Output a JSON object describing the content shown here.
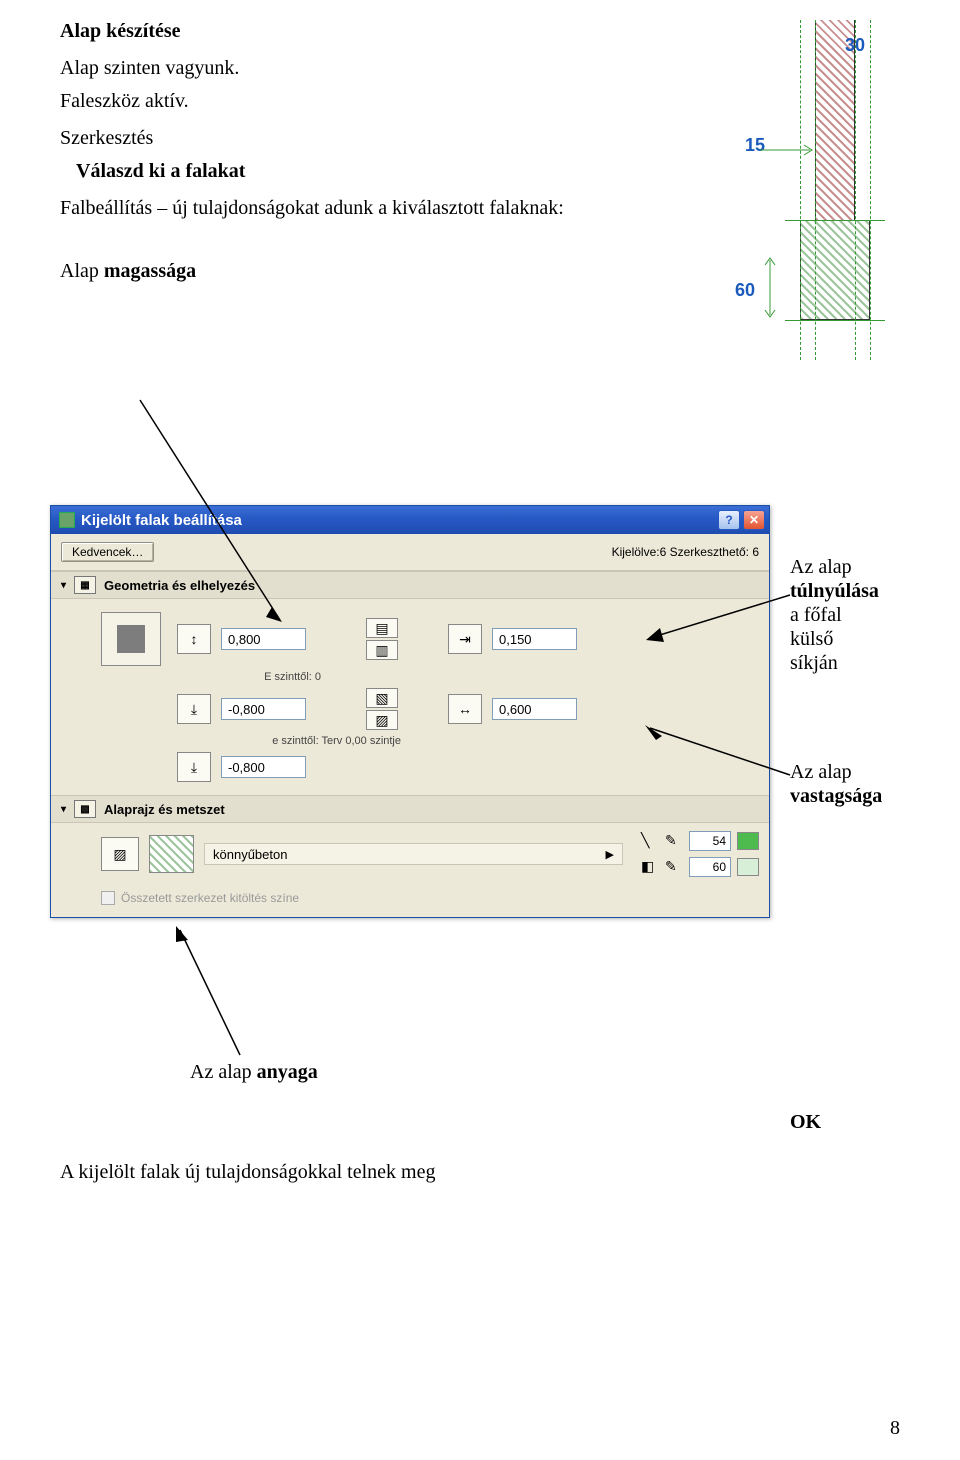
{
  "doc": {
    "h1": "Alap készítése",
    "p1": "Alap szinten vagyunk.",
    "p2": "Faleszköz aktív.",
    "p3a": "Szerkesztés",
    "p3b": "Válaszd ki a falakat",
    "p4": "Falbeállítás – új tulajdonságokat adunk a kiválasztott falaknak:",
    "l_magassaga_a": "Alap",
    "l_magassaga_b": " magassága",
    "annot_tulnyulas": "Az alap túlnyúlása a főfal külső síkján",
    "annot_tulnyulas_a": "Az alap",
    "annot_tulnyulas_b": "túlnyúlása",
    "annot_tulnyulas_c": "a főfal",
    "annot_tulnyulas_d": "külső",
    "annot_tulnyulas_e": "síkján",
    "annot_vastag_a": "Az alap",
    "annot_vastag_b": "vastagsága",
    "annot_anyaga_a": "Az alap",
    "annot_anyaga_b": " anyaga",
    "ok": "OK",
    "footer": "A kijelölt falak új tulajdonságokkal telnek meg",
    "pagenum": "8"
  },
  "diag": {
    "n30": "30",
    "n15": "15",
    "n60": "60"
  },
  "dialog": {
    "title": "Kijelölt falak beállítása",
    "kedvencek": "Kedvencek…",
    "kijelolve": "Kijelölve:6 Szerkesztheő: 6",
    "kijelolve2": "Kijelölve:6 Szerkesztheő: 6",
    "kijelolve_real": "Kijelölve:6 Szerkesztheő: 6",
    "kijelolve_actual": "Kijelölve:6 Szerkeszthető: 6",
    "sec_geo": "Geometria és elhelyezés",
    "sec_alap": "Alaprajz és metszet",
    "v_height": "0,800",
    "v_off1": "-0,800",
    "v_off2": "-0,800",
    "e_szinttol": "E szinttől: 0",
    "terv": "e szinttől: Terv 0,00 szintje",
    "v_ext": "0,150",
    "v_thick": "0,600",
    "material": "könnyűbeton",
    "pen1": "54",
    "pen2": "60",
    "chk": "Összetett szerkezet kitöltés színe"
  }
}
